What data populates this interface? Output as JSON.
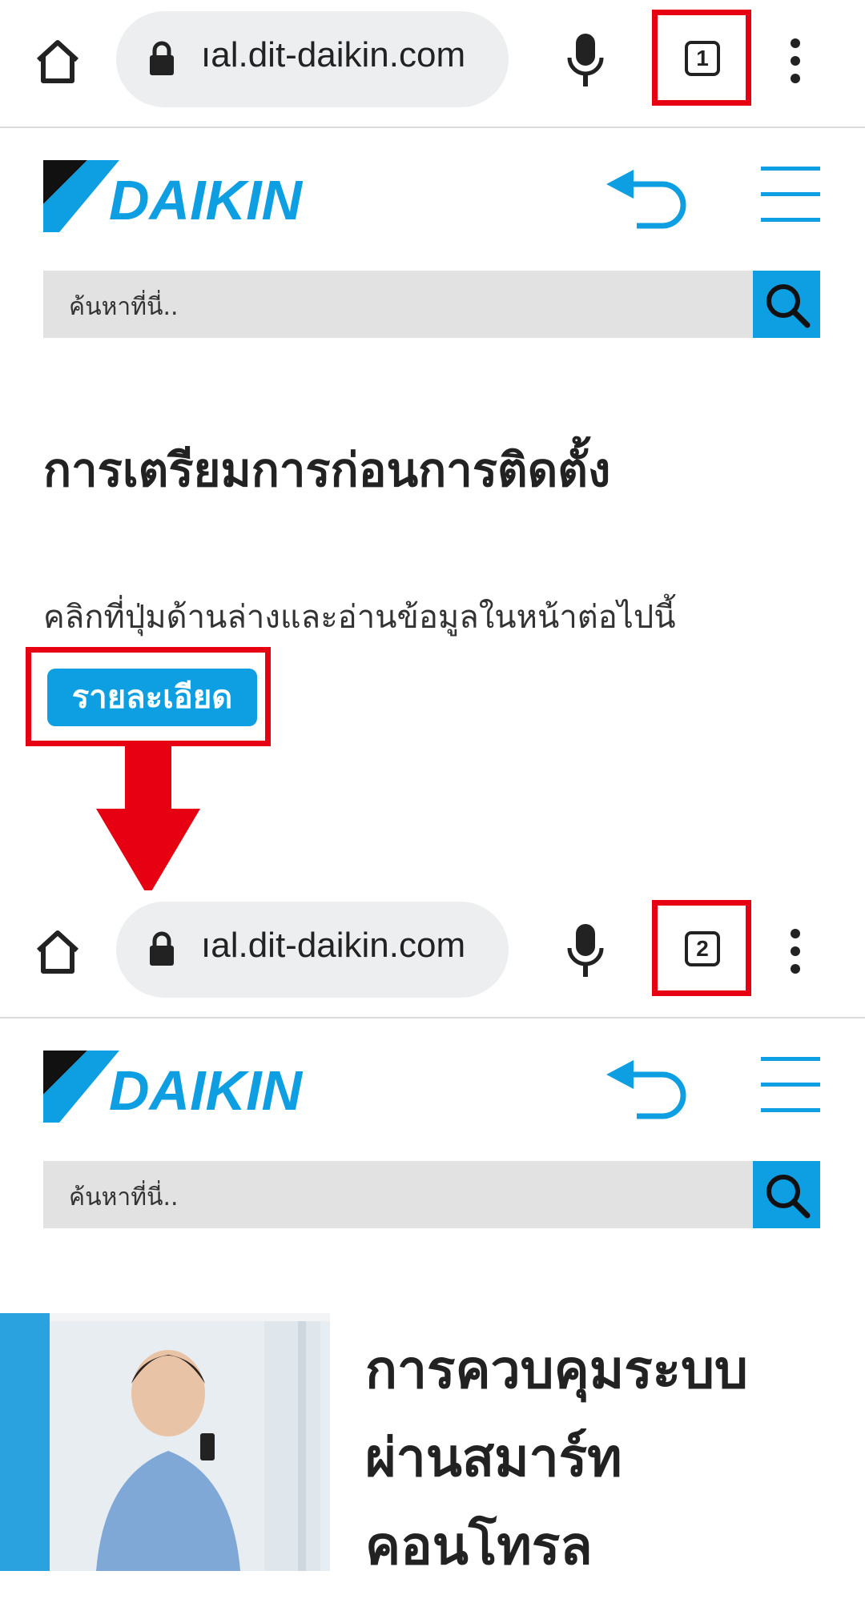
{
  "browser_top": {
    "url": "ıal.dit-daikin.com",
    "tab_count": "1"
  },
  "browser_bottom": {
    "url": "ıal.dit-daikin.com",
    "tab_count": "2"
  },
  "site": {
    "brand": "DAIKIN",
    "search_placeholder": "ค้นหาที่นี่.."
  },
  "page1": {
    "title": "การเตรียมการก่อนการติดตั้ง",
    "description": "คลิกที่ปุ่มด้านล่างและอ่านข้อมูลในหน้าต่อไปนี้",
    "detail_button": "รายละเอียด"
  },
  "page2": {
    "card_title_line1": "การควบคุมระบบ",
    "card_title_line2": "ผ่านสมาร์ท",
    "card_title_line3": "คอนโทรล"
  },
  "colors": {
    "accent": "#0e9ee2",
    "highlight": "#e60012",
    "search_bg": "#e2e2e2"
  },
  "icons": [
    "home-icon",
    "lock-icon",
    "mic-icon",
    "tab-switcher-icon",
    "more-vert-icon",
    "undo-icon",
    "hamburger-icon",
    "search-icon",
    "down-arrow-icon"
  ]
}
